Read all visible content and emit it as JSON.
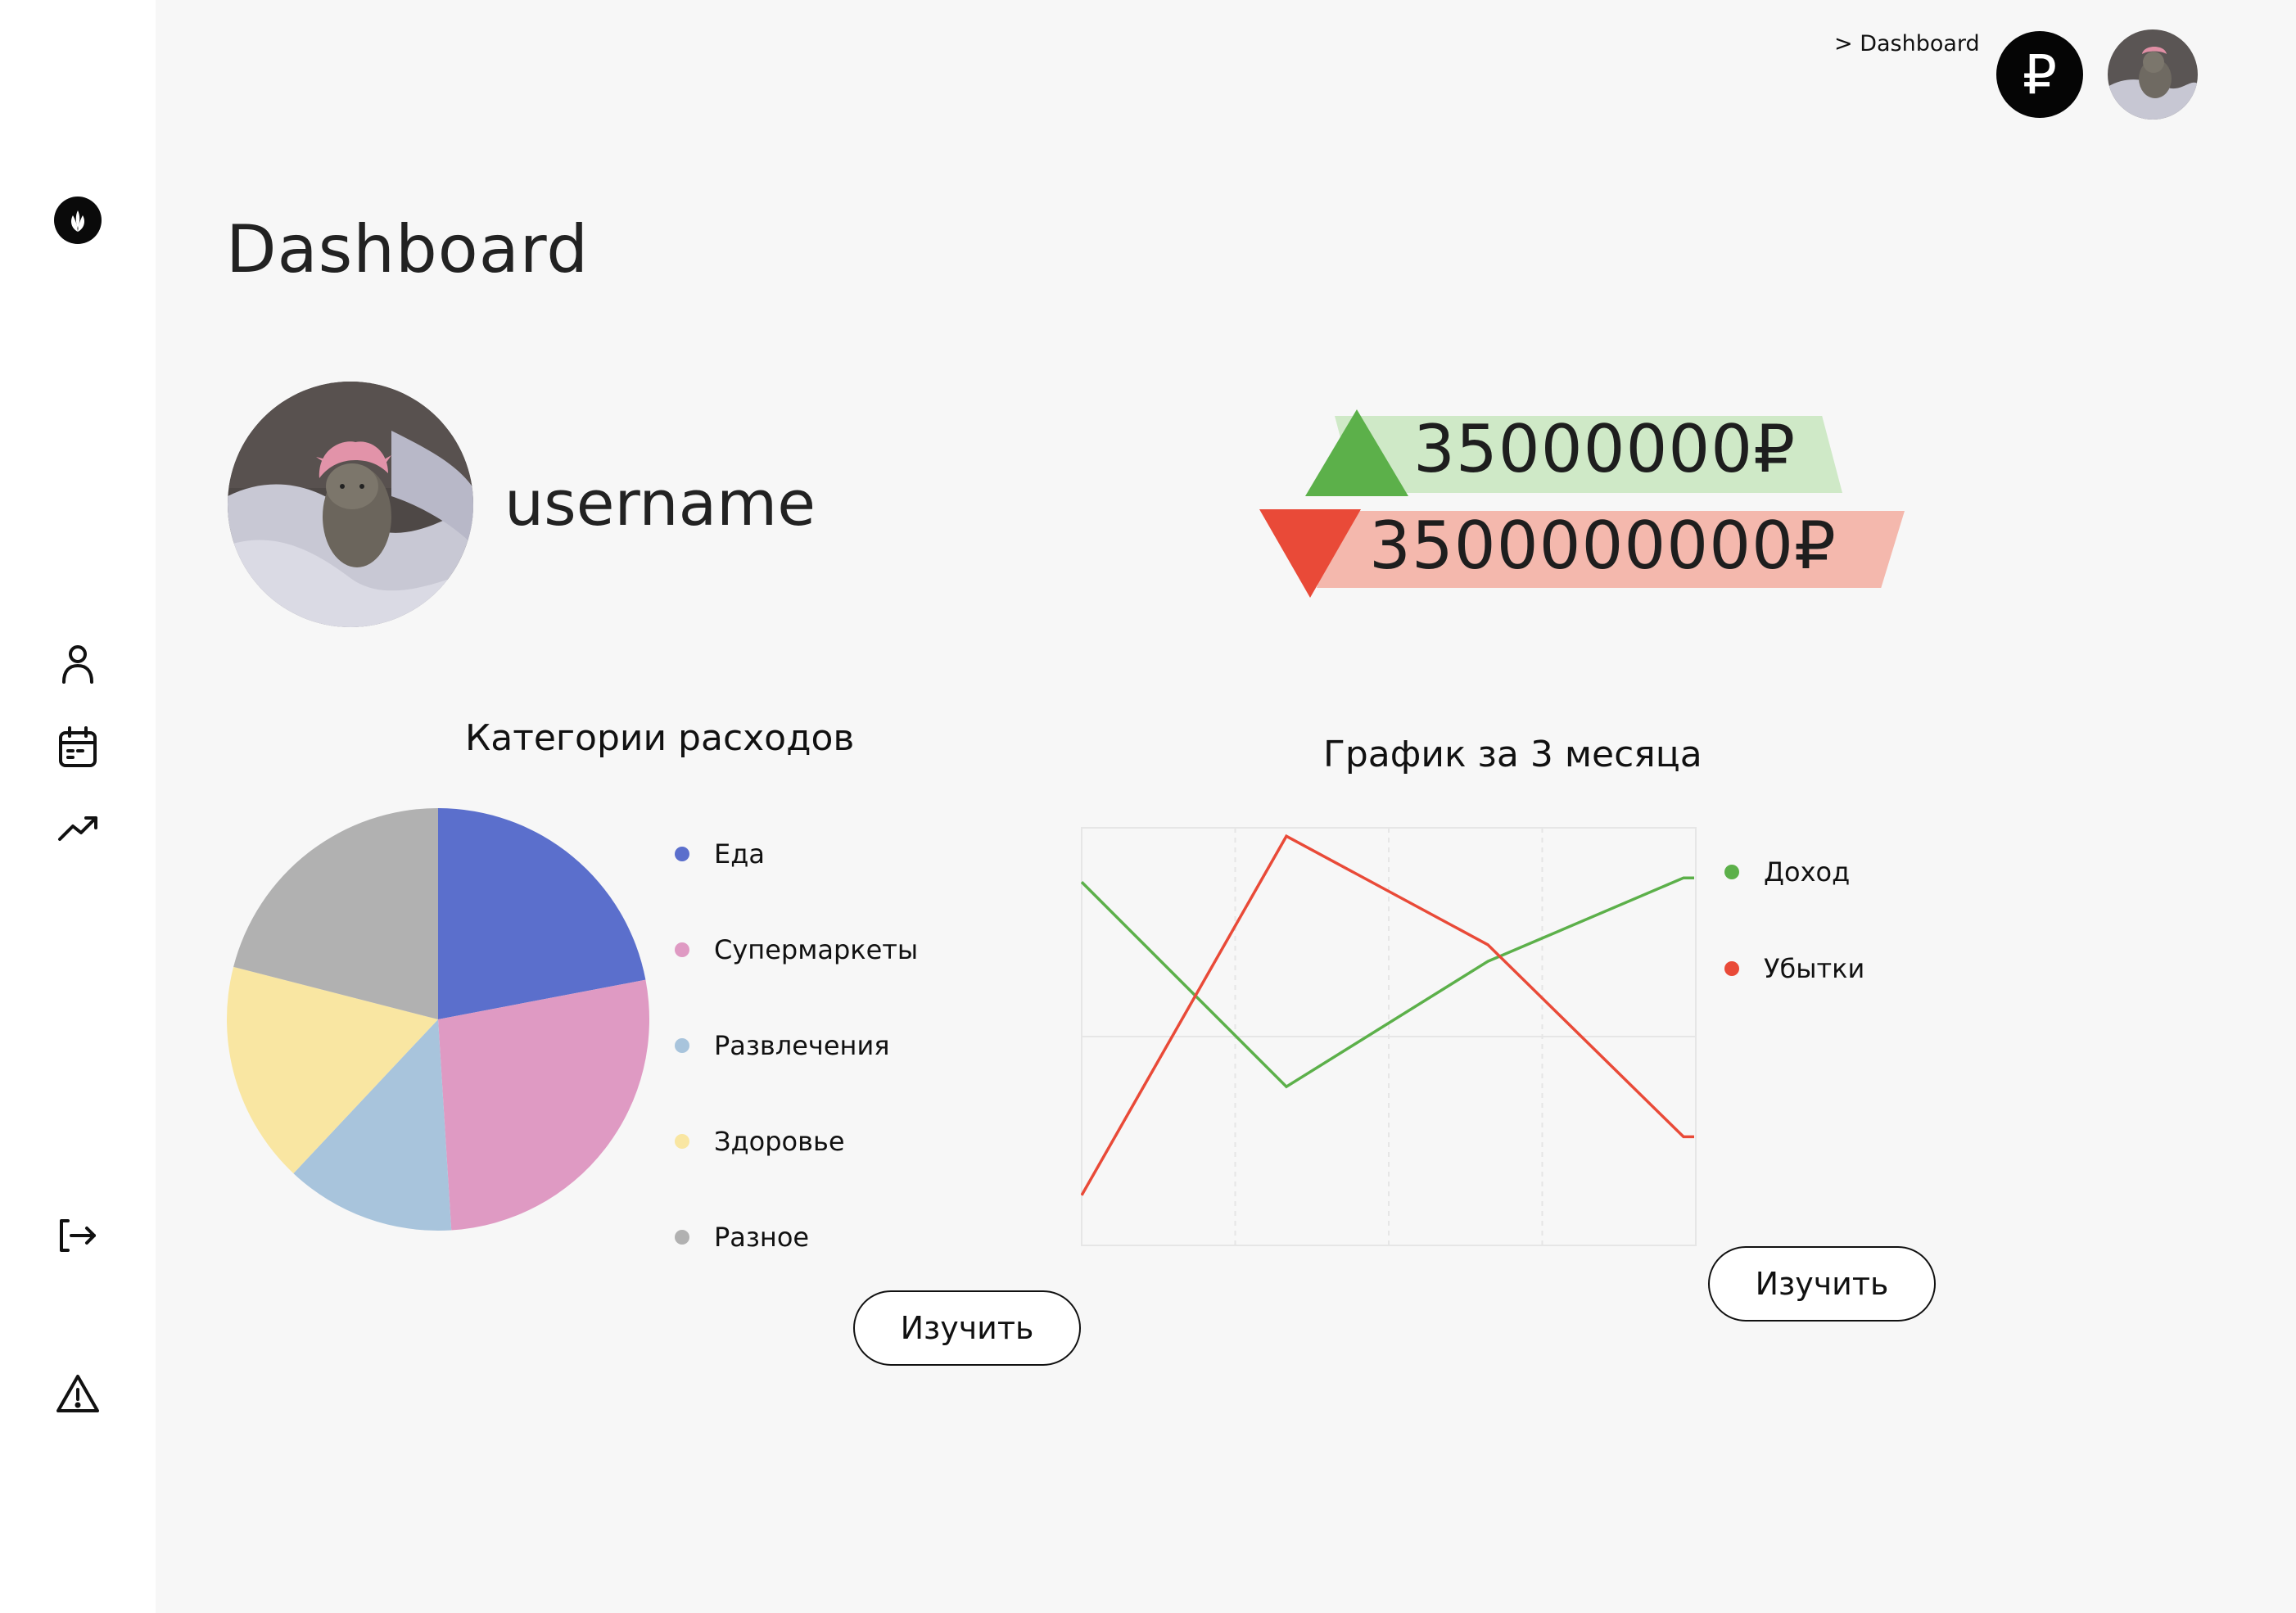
{
  "breadcrumb": {
    "text": "> Dashboard"
  },
  "header": {
    "currency_symbol": "₽"
  },
  "page": {
    "title": "Dashboard"
  },
  "profile": {
    "username": "username"
  },
  "balance": {
    "income": {
      "amount": "35000000₽",
      "color": "#5cb04a",
      "band_color": "#cfe9c7"
    },
    "loss": {
      "amount": "3500000000₽",
      "color": "#e94a38",
      "band_color": "#f4b8ad"
    }
  },
  "sidebar": {
    "icons": [
      "logo-leaf-icon",
      "user-icon",
      "calendar-icon",
      "trending-up-icon",
      "logout-icon",
      "warning-icon"
    ]
  },
  "expense_chart": {
    "title": "Категории расходов",
    "button_label": "Изучить"
  },
  "income_chart": {
    "title": "График за 3 месяца",
    "button_label": "Изучить"
  },
  "chart_data": [
    {
      "type": "pie",
      "title": "Категории расходов",
      "categories": [
        "Еда",
        "Супермаркеты",
        "Развлечения",
        "Здоровье",
        "Разное"
      ],
      "values": [
        22,
        27,
        13,
        17,
        21
      ],
      "colors": [
        "#5b6fcc",
        "#df9ac3",
        "#a8c4dc",
        "#f9e6a2",
        "#b1b1b1"
      ],
      "legend": "right"
    },
    {
      "type": "line",
      "title": "График за 3 месяца",
      "x": [
        0,
        1,
        2,
        3,
        4
      ],
      "ylim": [
        0,
        100
      ],
      "series": [
        {
          "name": "Доход",
          "values": [
            87,
            38,
            68,
            88,
            88
          ],
          "color": "#5cb04a"
        },
        {
          "name": "Убытки",
          "values": [
            12,
            98,
            72,
            26,
            26
          ],
          "color": "#e94a38"
        }
      ],
      "grid": true,
      "legend": "right"
    }
  ]
}
